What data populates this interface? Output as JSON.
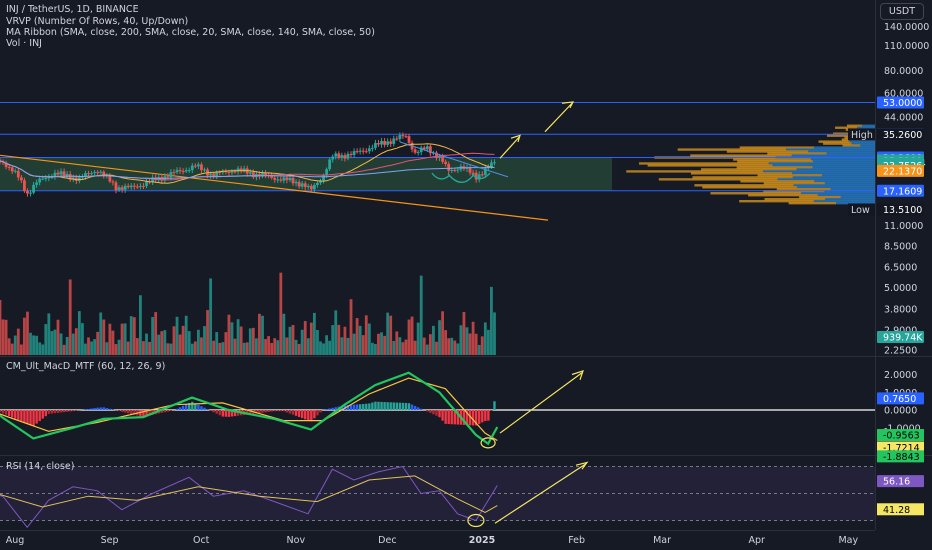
{
  "legend": {
    "title": "INJ / TetherUS, 1D, BINANCE",
    "vrvp": "VRVP (Number Of Rows, 40, Up/Down)",
    "ribbon": "MA Ribbon (SMA, close, 200, SMA, close, 20, SMA, close, 140, SMA, close, 50)",
    "vol": "Vol · INJ",
    "macd": "CM_Ult_MacD_MTF (60, 12, 26, 9)",
    "rsi": "RSI (14, close)"
  },
  "currency": "USDT",
  "colors": {
    "bg": "#161a25",
    "up": "#26a69a",
    "down": "#ef5350",
    "blue_line": "#2962ff",
    "range_fill": "#2e5b3f",
    "orange": "#f7931a",
    "yellow": "#f5e663",
    "rsi_line": "#7e57c2",
    "rsi_ma": "#e3c158"
  },
  "chart_data": [
    {
      "type": "candlestick",
      "title": "INJ / TetherUS, 1D, BINANCE",
      "scale": "log",
      "x_labels": [
        "Aug",
        "Sep",
        "Oct",
        "Nov",
        "Dec",
        "2025",
        "Feb",
        "Mar",
        "Apr",
        "May"
      ],
      "y_ticks": [
        140.0,
        110.0,
        80.0,
        60.0,
        44.0,
        35.26,
        26.2608,
        17.1609,
        11.0,
        8.5,
        6.5,
        5.0,
        3.8,
        2.9,
        2.25
      ],
      "y_tick_labels": [
        "140.0000",
        "110.0000",
        "80.0000",
        "60.0000",
        "44.0000",
        "35.2600",
        "26.2608",
        "17.1609",
        "11.0000",
        "8.5000",
        "6.5000",
        "5.0000",
        "3.8000",
        "2.9000",
        "2.2500"
      ],
      "price_labels": [
        {
          "label": "53.0000",
          "value": 53.0,
          "color": "#2962ff"
        },
        {
          "label": "35.3592",
          "value": 35.3592,
          "color": "#2962ff"
        },
        {
          "label": "35.2600",
          "value": 35.26,
          "color": "#131722",
          "tag": "High"
        },
        {
          "label": "26.2608",
          "value": 26.2608,
          "color": "#2962ff"
        },
        {
          "label": "25.3100",
          "value": 25.31,
          "color": "#26a69a"
        },
        {
          "label": "01:18:04",
          "value": 24.4,
          "color": "#26a69a"
        },
        {
          "label": "23.7526",
          "value": 23.7526,
          "color": "#26a69a"
        },
        {
          "label": "22.1370",
          "value": 22.137,
          "color": "#f7931a"
        },
        {
          "label": "17.1609",
          "value": 17.1609,
          "color": "#2962ff"
        },
        {
          "label": "13.5100",
          "value": 13.51,
          "color": "#131722",
          "tag": "Low"
        }
      ],
      "horizontal_levels": [
        53.0,
        35.3592,
        26.2608,
        17.1609
      ],
      "range_zone": [
        17.1609,
        26.2608
      ],
      "close_path": [
        {
          "date": "2024-07-20",
          "close": 25.5
        },
        {
          "date": "2024-07-28",
          "close": 25.0
        },
        {
          "date": "2024-08-02",
          "close": 20.5
        },
        {
          "date": "2024-08-05",
          "close": 16.5
        },
        {
          "date": "2024-08-08",
          "close": 19.0
        },
        {
          "date": "2024-08-14",
          "close": 21.5
        },
        {
          "date": "2024-08-22",
          "close": 20.0
        },
        {
          "date": "2024-08-28",
          "close": 22.5
        },
        {
          "date": "2024-09-03",
          "close": 18.0
        },
        {
          "date": "2024-09-08",
          "close": 17.8
        },
        {
          "date": "2024-09-15",
          "close": 19.5
        },
        {
          "date": "2024-09-22",
          "close": 21.5
        },
        {
          "date": "2024-09-29",
          "close": 23.5
        },
        {
          "date": "2024-10-05",
          "close": 21.0
        },
        {
          "date": "2024-10-12",
          "close": 22.5
        },
        {
          "date": "2024-10-20",
          "close": 21.0
        },
        {
          "date": "2024-10-28",
          "close": 19.8
        },
        {
          "date": "2024-11-03",
          "close": 18.8
        },
        {
          "date": "2024-11-06",
          "close": 17.2
        },
        {
          "date": "2024-11-10",
          "close": 21.0
        },
        {
          "date": "2024-11-13",
          "close": 26.5
        },
        {
          "date": "2024-11-20",
          "close": 27.5
        },
        {
          "date": "2024-11-27",
          "close": 30.5
        },
        {
          "date": "2024-12-03",
          "close": 33.0
        },
        {
          "date": "2024-12-07",
          "close": 34.5
        },
        {
          "date": "2024-12-10",
          "close": 28.0
        },
        {
          "date": "2024-12-14",
          "close": 29.5
        },
        {
          "date": "2024-12-18",
          "close": 26.5
        },
        {
          "date": "2024-12-21",
          "close": 22.0
        },
        {
          "date": "2024-12-25",
          "close": 23.5
        },
        {
          "date": "2024-12-30",
          "close": 20.5
        },
        {
          "date": "2025-01-03",
          "close": 23.0
        },
        {
          "date": "2025-01-06",
          "close": 25.31
        }
      ],
      "annotations": [
        "descending trendline",
        "MA ribbon",
        "inverse head and shoulders",
        "projection arrows to 35.35 and 53.00",
        "volume profile (VRVP)"
      ]
    },
    {
      "type": "bar",
      "title": "Vol · INJ",
      "last_volume_label": "939.74K"
    },
    {
      "type": "histogram",
      "title": "CM_Ult_MacD_MTF (60, 12, 26, 9)",
      "y_ticks": [
        2.0,
        1.0,
        0.0,
        -1.0,
        -2.0
      ],
      "y_tick_labels": [
        "2.0000",
        "1.0000",
        "0.0000",
        "-1.0000",
        "-2.0000"
      ],
      "ylim": [
        -2.6,
        2.9
      ],
      "last_histogram": 0.765,
      "last_histogram_label": "0.7650",
      "macd_value_label": "-0.9563",
      "signal_value_label": "-1.7214",
      "third_value_label": "-1.8843",
      "macd_path": [
        {
          "date": "2024-07-20",
          "value": 0.5
        },
        {
          "date": "2024-08-07",
          "value": -1.6
        },
        {
          "date": "2024-08-20",
          "value": -1.0
        },
        {
          "date": "2024-08-30",
          "value": -0.5
        },
        {
          "date": "2024-09-12",
          "value": -0.4
        },
        {
          "date": "2024-09-28",
          "value": 0.7
        },
        {
          "date": "2024-10-10",
          "value": 0.0
        },
        {
          "date": "2024-10-25",
          "value": -0.5
        },
        {
          "date": "2024-11-06",
          "value": -1.1
        },
        {
          "date": "2024-11-17",
          "value": 0.3
        },
        {
          "date": "2024-11-27",
          "value": 1.4
        },
        {
          "date": "2024-12-08",
          "value": 2.1
        },
        {
          "date": "2024-12-18",
          "value": 1.0
        },
        {
          "date": "2024-12-30",
          "value": -1.4
        },
        {
          "date": "2025-01-03",
          "value": -1.9
        },
        {
          "date": "2025-01-06",
          "value": -0.96
        }
      ],
      "signal_path": [
        {
          "date": "2024-07-20",
          "value": 0.2
        },
        {
          "date": "2024-08-12",
          "value": -1.2
        },
        {
          "date": "2024-08-28",
          "value": -0.7
        },
        {
          "date": "2024-09-22",
          "value": 0.3
        },
        {
          "date": "2024-10-08",
          "value": 0.4
        },
        {
          "date": "2024-10-28",
          "value": -0.6
        },
        {
          "date": "2024-11-10",
          "value": -0.6
        },
        {
          "date": "2024-11-25",
          "value": 0.9
        },
        {
          "date": "2024-12-08",
          "value": 1.8
        },
        {
          "date": "2024-12-20",
          "value": 1.2
        },
        {
          "date": "2025-01-02",
          "value": -1.3
        },
        {
          "date": "2025-01-06",
          "value": -1.72
        }
      ]
    },
    {
      "type": "line",
      "title": "RSI (14, close)",
      "y_ticks": [
        70,
        50,
        30
      ],
      "ylim": [
        20,
        80
      ],
      "rsi_label": "56.16",
      "rsi_ma_label": "41.28",
      "rsi_path": [
        {
          "date": "2024-07-20",
          "value": 52
        },
        {
          "date": "2024-07-28",
          "value": 48
        },
        {
          "date": "2024-08-05",
          "value": 25
        },
        {
          "date": "2024-08-12",
          "value": 45
        },
        {
          "date": "2024-08-20",
          "value": 55
        },
        {
          "date": "2024-08-28",
          "value": 52
        },
        {
          "date": "2024-09-05",
          "value": 38
        },
        {
          "date": "2024-09-15",
          "value": 50
        },
        {
          "date": "2024-09-27",
          "value": 62
        },
        {
          "date": "2024-10-05",
          "value": 48
        },
        {
          "date": "2024-10-15",
          "value": 52
        },
        {
          "date": "2024-10-25",
          "value": 44
        },
        {
          "date": "2024-11-05",
          "value": 35
        },
        {
          "date": "2024-11-13",
          "value": 68
        },
        {
          "date": "2024-11-20",
          "value": 60
        },
        {
          "date": "2024-11-28",
          "value": 66
        },
        {
          "date": "2024-12-06",
          "value": 70
        },
        {
          "date": "2024-12-12",
          "value": 50
        },
        {
          "date": "2024-12-18",
          "value": 52
        },
        {
          "date": "2024-12-24",
          "value": 35
        },
        {
          "date": "2024-12-30",
          "value": 30
        },
        {
          "date": "2025-01-06",
          "value": 56
        }
      ],
      "rsi_ma_path": [
        {
          "date": "2024-07-20",
          "value": 54
        },
        {
          "date": "2024-08-10",
          "value": 40
        },
        {
          "date": "2024-08-25",
          "value": 48
        },
        {
          "date": "2024-09-10",
          "value": 45
        },
        {
          "date": "2024-09-30",
          "value": 55
        },
        {
          "date": "2024-10-20",
          "value": 48
        },
        {
          "date": "2024-11-08",
          "value": 44
        },
        {
          "date": "2024-11-25",
          "value": 60
        },
        {
          "date": "2024-12-10",
          "value": 63
        },
        {
          "date": "2024-12-24",
          "value": 46
        },
        {
          "date": "2025-01-02",
          "value": 36
        },
        {
          "date": "2025-01-06",
          "value": 41
        }
      ]
    }
  ]
}
